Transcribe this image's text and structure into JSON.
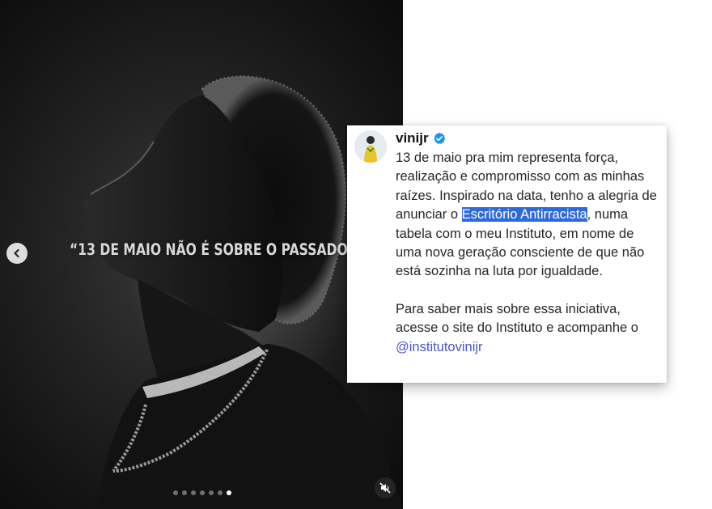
{
  "media": {
    "overlay_text": "“13 DE MAIO NÃO É SOBRE O PASSADO",
    "carousel": {
      "total_slides": 7,
      "active_slide": 7
    },
    "prev_icon": "chevron-left-icon",
    "mute_icon": "speaker-muted-icon"
  },
  "post": {
    "username": "vinijr",
    "verified_icon": "verified-badge-icon",
    "caption": {
      "p1_part1": "13 de maio pra mim representa força, realização e compromisso com as minhas raízes. Inspirado na data, tenho a alegria de anunciar o ",
      "p1_highlight": "Escritório Antirracista",
      "p1_part2": ", numa tabela com o meu Instituto, em nome de uma nova geração consciente de que não está sozinha na luta por igualdade.",
      "p2_part1": "Para saber mais sobre essa iniciativa, acesse o site do Instituto e acompanhe o ",
      "p2_mention": "@institutovinijr"
    }
  },
  "colors": {
    "highlight": "#2f6ad9",
    "mention": "#4a55c9",
    "verified": "#1c96f0"
  }
}
